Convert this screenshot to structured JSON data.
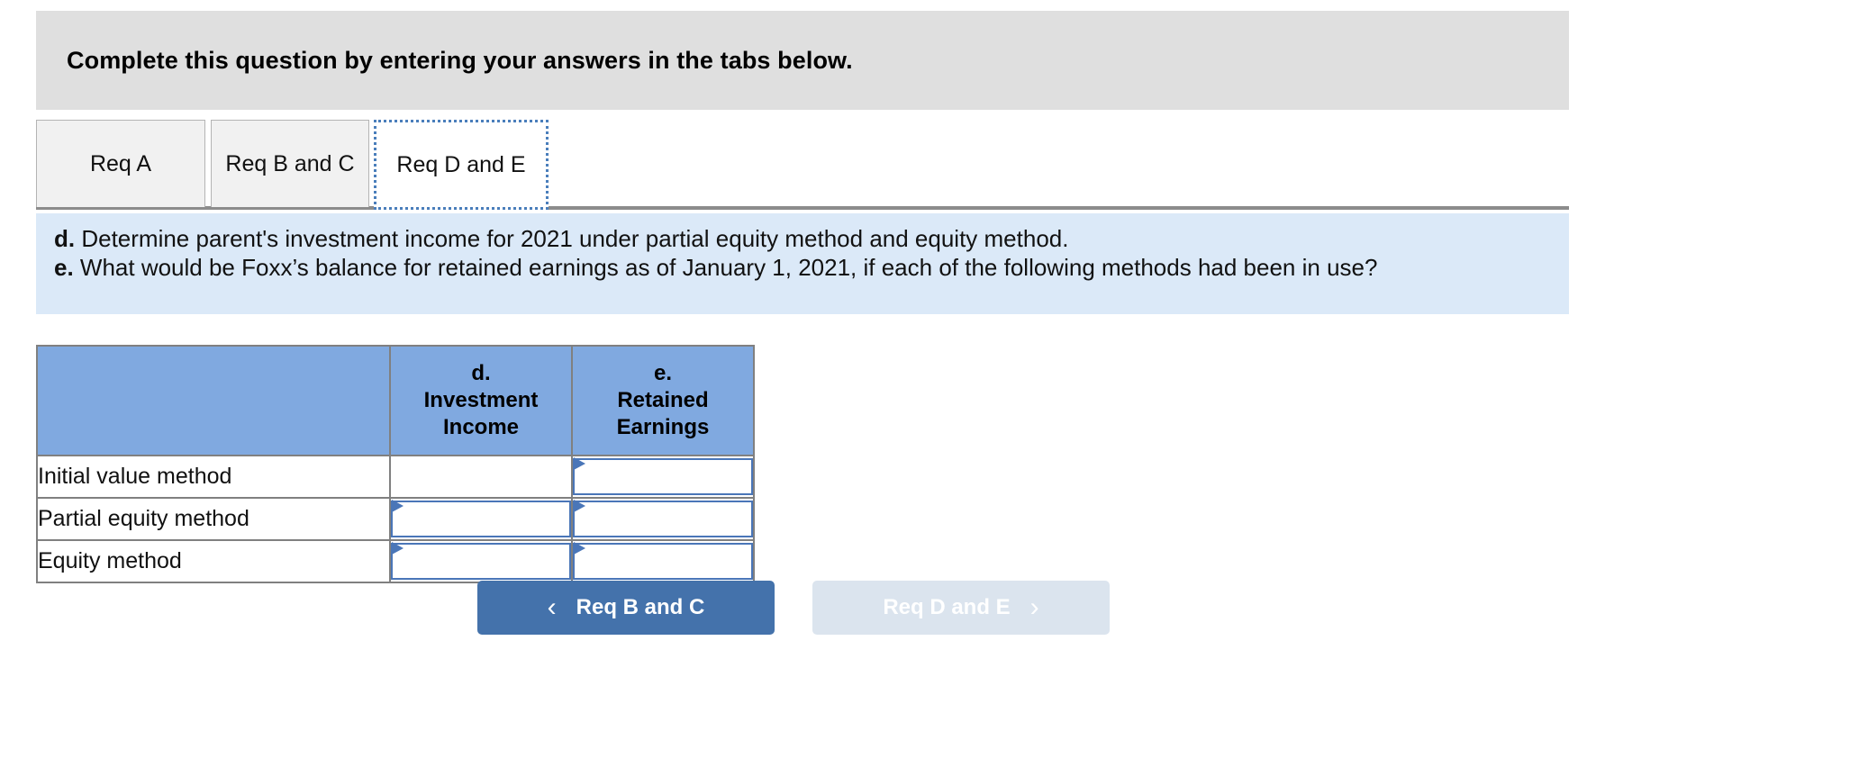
{
  "instruction": {
    "text": "Complete this question by entering your answers in the tabs below."
  },
  "tabs": [
    {
      "label": "Req A",
      "active": false
    },
    {
      "label": "Req B and C",
      "active": false
    },
    {
      "label": "Req D and E",
      "active": true
    }
  ],
  "question": {
    "line_d_label": "d.",
    "line_d_text": " Determine parent's investment income for 2021 under partial equity method and equity method.",
    "line_e_label": "e.",
    "line_e_text": " What would be Foxx’s balance for retained earnings as of January 1, 2021, if each of the following methods had been in use?"
  },
  "table": {
    "headers": {
      "label_col": "",
      "col_d_line1": "d.",
      "col_d_line2": "Investment",
      "col_d_line3": "Income",
      "col_e_line1": "e.",
      "col_e_line2": "Retained",
      "col_e_line3": "Earnings"
    },
    "rows": [
      {
        "label": "Initial value method",
        "investment_income": "",
        "investment_income_has_input": false,
        "retained_earnings": "",
        "retained_earnings_has_input": true
      },
      {
        "label": "Partial equity method",
        "investment_income": "",
        "investment_income_has_input": true,
        "retained_earnings": "",
        "retained_earnings_has_input": true
      },
      {
        "label": "Equity method",
        "investment_income": "",
        "investment_income_has_input": true,
        "retained_earnings": "",
        "retained_earnings_has_input": true
      }
    ]
  },
  "navigation": {
    "prev_label": "Req B and C",
    "prev_icon": "chevron-left-icon",
    "prev_glyph": "‹",
    "next_label": "Req D and E",
    "next_icon": "chevron-right-icon",
    "next_glyph": "›"
  },
  "colors": {
    "instruction_bg": "#dfdfdf",
    "question_bg": "#dbe9f8",
    "table_header_bg": "#80a9e0",
    "table_border": "#808080",
    "input_border": "#4a76b8",
    "active_tab_focus": "#4a7ebb",
    "nav_prev_bg": "#4472ab",
    "nav_next_bg": "#dbe4ee"
  }
}
